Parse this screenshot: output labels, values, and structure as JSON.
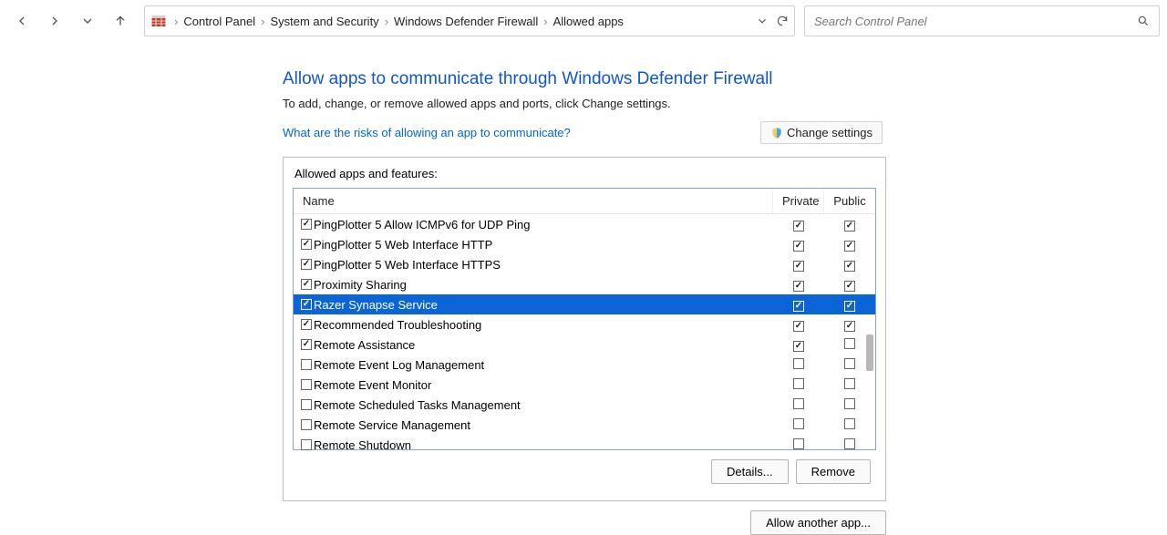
{
  "breadcrumb": [
    "Control Panel",
    "System and Security",
    "Windows Defender Firewall",
    "Allowed apps"
  ],
  "search": {
    "placeholder": "Search Control Panel"
  },
  "page": {
    "title": "Allow apps to communicate through Windows Defender Firewall",
    "desc": "To add, change, or remove allowed apps and ports, click Change settings.",
    "risk_link": "What are the risks of allowing an app to communicate?",
    "change_settings": "Change settings",
    "group_label": "Allowed apps and features:"
  },
  "columns": {
    "name": "Name",
    "private": "Private",
    "public": "Public"
  },
  "rows": [
    {
      "name": "PingPlotter 5 Allow ICMPv6 for UDP Ping",
      "enabled": true,
      "private": true,
      "public": true,
      "selected": false
    },
    {
      "name": "PingPlotter 5 Web Interface HTTP",
      "enabled": true,
      "private": true,
      "public": true,
      "selected": false
    },
    {
      "name": "PingPlotter 5 Web Interface HTTPS",
      "enabled": true,
      "private": true,
      "public": true,
      "selected": false
    },
    {
      "name": "Proximity Sharing",
      "enabled": true,
      "private": true,
      "public": true,
      "selected": false
    },
    {
      "name": "Razer Synapse Service",
      "enabled": true,
      "private": true,
      "public": true,
      "selected": true
    },
    {
      "name": "Recommended Troubleshooting",
      "enabled": true,
      "private": true,
      "public": true,
      "selected": false
    },
    {
      "name": "Remote Assistance",
      "enabled": true,
      "private": true,
      "public": false,
      "selected": false
    },
    {
      "name": "Remote Event Log Management",
      "enabled": false,
      "private": false,
      "public": false,
      "selected": false
    },
    {
      "name": "Remote Event Monitor",
      "enabled": false,
      "private": false,
      "public": false,
      "selected": false
    },
    {
      "name": "Remote Scheduled Tasks Management",
      "enabled": false,
      "private": false,
      "public": false,
      "selected": false
    },
    {
      "name": "Remote Service Management",
      "enabled": false,
      "private": false,
      "public": false,
      "selected": false
    },
    {
      "name": "Remote Shutdown",
      "enabled": false,
      "private": false,
      "public": false,
      "selected": false
    }
  ],
  "buttons": {
    "details": "Details...",
    "remove": "Remove",
    "allow": "Allow another app..."
  }
}
